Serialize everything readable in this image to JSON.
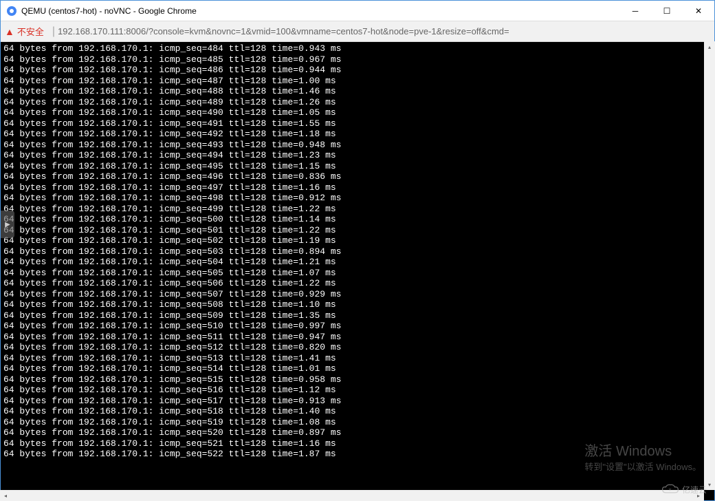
{
  "window": {
    "title": "QEMU (centos7-hot) - noVNC - Google Chrome"
  },
  "addressbar": {
    "warn_label": "不安全",
    "url": "192.168.170.111:8006/?console=kvm&novnc=1&vmid=100&vmname=centos7-hot&node=pve-1&resize=off&cmd="
  },
  "ping": {
    "prefix": "64 bytes from ",
    "host": "192.168.170.1",
    "ttl": "128",
    "rows": [
      {
        "seq": "484",
        "time": "0.943"
      },
      {
        "seq": "485",
        "time": "0.967"
      },
      {
        "seq": "486",
        "time": "0.944"
      },
      {
        "seq": "487",
        "time": "1.00"
      },
      {
        "seq": "488",
        "time": "1.46"
      },
      {
        "seq": "489",
        "time": "1.26"
      },
      {
        "seq": "490",
        "time": "1.05"
      },
      {
        "seq": "491",
        "time": "1.55"
      },
      {
        "seq": "492",
        "time": "1.18"
      },
      {
        "seq": "493",
        "time": "0.948"
      },
      {
        "seq": "494",
        "time": "1.23"
      },
      {
        "seq": "495",
        "time": "1.15"
      },
      {
        "seq": "496",
        "time": "0.836"
      },
      {
        "seq": "497",
        "time": "1.16"
      },
      {
        "seq": "498",
        "time": "0.912"
      },
      {
        "seq": "499",
        "time": "1.22"
      },
      {
        "seq": "500",
        "time": "1.14"
      },
      {
        "seq": "501",
        "time": "1.22"
      },
      {
        "seq": "502",
        "time": "1.19"
      },
      {
        "seq": "503",
        "time": "0.894"
      },
      {
        "seq": "504",
        "time": "1.21"
      },
      {
        "seq": "505",
        "time": "1.07"
      },
      {
        "seq": "506",
        "time": "1.22"
      },
      {
        "seq": "507",
        "time": "0.929"
      },
      {
        "seq": "508",
        "time": "1.10"
      },
      {
        "seq": "509",
        "time": "1.35"
      },
      {
        "seq": "510",
        "time": "0.997"
      },
      {
        "seq": "511",
        "time": "0.947"
      },
      {
        "seq": "512",
        "time": "0.820"
      },
      {
        "seq": "513",
        "time": "1.41"
      },
      {
        "seq": "514",
        "time": "1.01"
      },
      {
        "seq": "515",
        "time": "0.958"
      },
      {
        "seq": "516",
        "time": "1.12"
      },
      {
        "seq": "517",
        "time": "0.913"
      },
      {
        "seq": "518",
        "time": "1.40"
      },
      {
        "seq": "519",
        "time": "1.08"
      },
      {
        "seq": "520",
        "time": "0.897"
      },
      {
        "seq": "521",
        "time": "1.16"
      },
      {
        "seq": "522",
        "time": "1.87"
      }
    ]
  },
  "watermark": {
    "title": "激活 Windows",
    "subtitle": "转到\"设置\"以激活 Windows。"
  },
  "cloud": {
    "label": "亿速云"
  }
}
